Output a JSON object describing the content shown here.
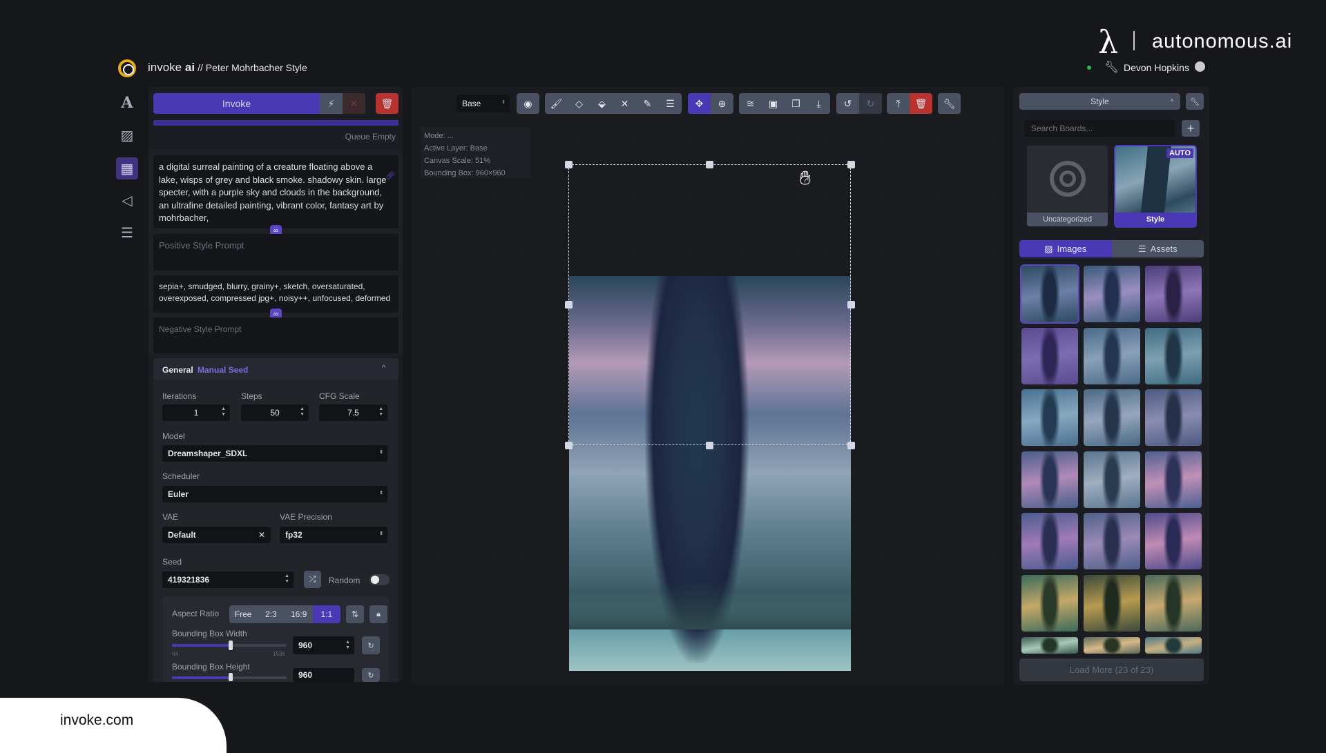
{
  "header": {
    "brand_light": "invoke ",
    "brand_bold": "ai",
    "project": "// Peter Mohrbacher Style"
  },
  "branding": {
    "partner": "autonomous.ai",
    "symbol": "λ",
    "footer": "invoke.com"
  },
  "user": {
    "name": "Devon Hopkins",
    "status_color": "#2fb84f"
  },
  "nav": [
    {
      "icon": "text-icon",
      "glyph": "A"
    },
    {
      "icon": "image-icon",
      "glyph": "▨"
    },
    {
      "icon": "canvas-grid-icon",
      "glyph": "▦",
      "active": true
    },
    {
      "icon": "workflow-icon",
      "glyph": "◁"
    },
    {
      "icon": "menu-icon",
      "glyph": "☰"
    }
  ],
  "queue": {
    "invoke_label": "Invoke",
    "status": "Queue Empty"
  },
  "prompts": {
    "positive": "a digital surreal painting of a creature floating above a lake, wisps of grey and black smoke. shadowy skin. large specter, with a purple sky and clouds in the background, an ultrafine detailed painting, vibrant color, fantasy art by mohrbacher,",
    "positive_style_placeholder": "Positive Style Prompt",
    "negative": "sepia+, smudged, blurry, grainy+,  sketch, oversaturated, overexposed, compressed jpg+, noisy++, unfocused, deformed",
    "negative_style_placeholder": "Negative Style Prompt"
  },
  "general": {
    "title": "General",
    "badge": "Manual Seed",
    "iterations_label": "Iterations",
    "iterations": "1",
    "steps_label": "Steps",
    "steps": "50",
    "cfg_label": "CFG Scale",
    "cfg": "7.5",
    "model_label": "Model",
    "model": "Dreamshaper_SDXL",
    "scheduler_label": "Scheduler",
    "scheduler": "Euler",
    "vae_label": "VAE",
    "vae": "Default",
    "vae_precision_label": "VAE Precision",
    "vae_precision": "fp32",
    "seed_label": "Seed",
    "seed": "419321836",
    "random_label": "Random",
    "random_on": false,
    "aspect_label": "Aspect Ratio",
    "aspect_options": [
      "Free",
      "2:3",
      "16:9",
      "1:1"
    ],
    "aspect_selected": "1:1",
    "bbw_label": "Bounding Box Width",
    "bbw": "960",
    "bbh_label": "Bounding Box Height",
    "bbh": "960",
    "slider_min": "64",
    "slider_max": "1536"
  },
  "canvas": {
    "layer_select": "Base",
    "info": {
      "mode": "Mode: ...",
      "layer": "Active Layer: Base",
      "scale": "Canvas Scale: 51%",
      "bbox": "Bounding Box: 960×960"
    }
  },
  "gallery": {
    "board_select": "Style",
    "search_placeholder": "Search Boards...",
    "boards": [
      {
        "name": "Uncategorized"
      },
      {
        "name": "Style",
        "badge": "AUTO",
        "selected": true
      }
    ],
    "tabs": [
      "Images",
      "Assets"
    ],
    "active_tab": "Images",
    "load_more": "Load More (23 of 23)"
  },
  "colors": {
    "accent": "#4a38b4",
    "danger": "#b8332f",
    "button": "#4a5163"
  }
}
